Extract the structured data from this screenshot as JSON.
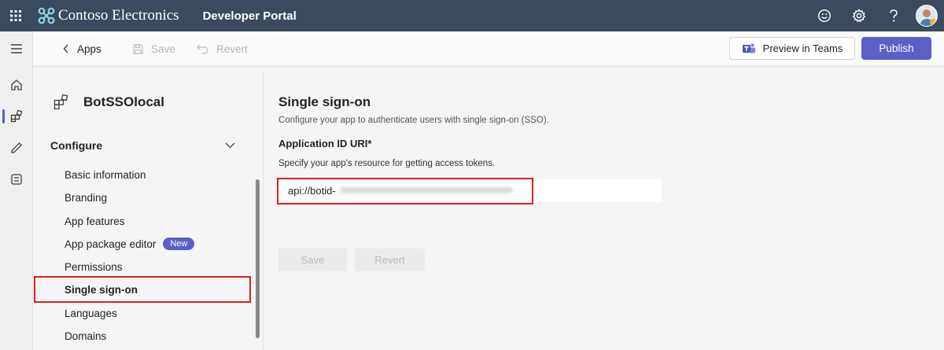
{
  "topbar": {
    "brand": "Contoso Electronics",
    "portal": "Developer Portal",
    "icons": [
      "waffle-icon",
      "smiley-icon",
      "settings-icon",
      "help-icon",
      "avatar"
    ]
  },
  "rail": {
    "items": [
      "hamburger-icon",
      "home-icon",
      "apps-icon",
      "tools-icon",
      "forms-icon"
    ]
  },
  "cmdbar": {
    "back": "Apps",
    "save": "Save",
    "revert": "Revert",
    "preview": "Preview in Teams",
    "publish": "Publish"
  },
  "nav": {
    "app_name": "BotSSOlocal",
    "section": "Configure",
    "items": [
      {
        "label": "Basic information"
      },
      {
        "label": "Branding"
      },
      {
        "label": "App features"
      },
      {
        "label": "App package editor",
        "badge": "New"
      },
      {
        "label": "Permissions"
      },
      {
        "label": "Single sign-on",
        "selected": true
      },
      {
        "label": "Languages"
      },
      {
        "label": "Domains"
      }
    ]
  },
  "content": {
    "title": "Single sign-on",
    "description": "Configure your app to authenticate users with single sign-on (SSO).",
    "field_label": "Application ID URI*",
    "field_help": "Specify your app's resource for getting access tokens.",
    "uri_value": "api://botid-",
    "save": "Save",
    "revert": "Revert"
  },
  "colors": {
    "topbar": "#3b4a5c",
    "accent": "#5b5fc7",
    "highlight": "#e01e1e"
  }
}
